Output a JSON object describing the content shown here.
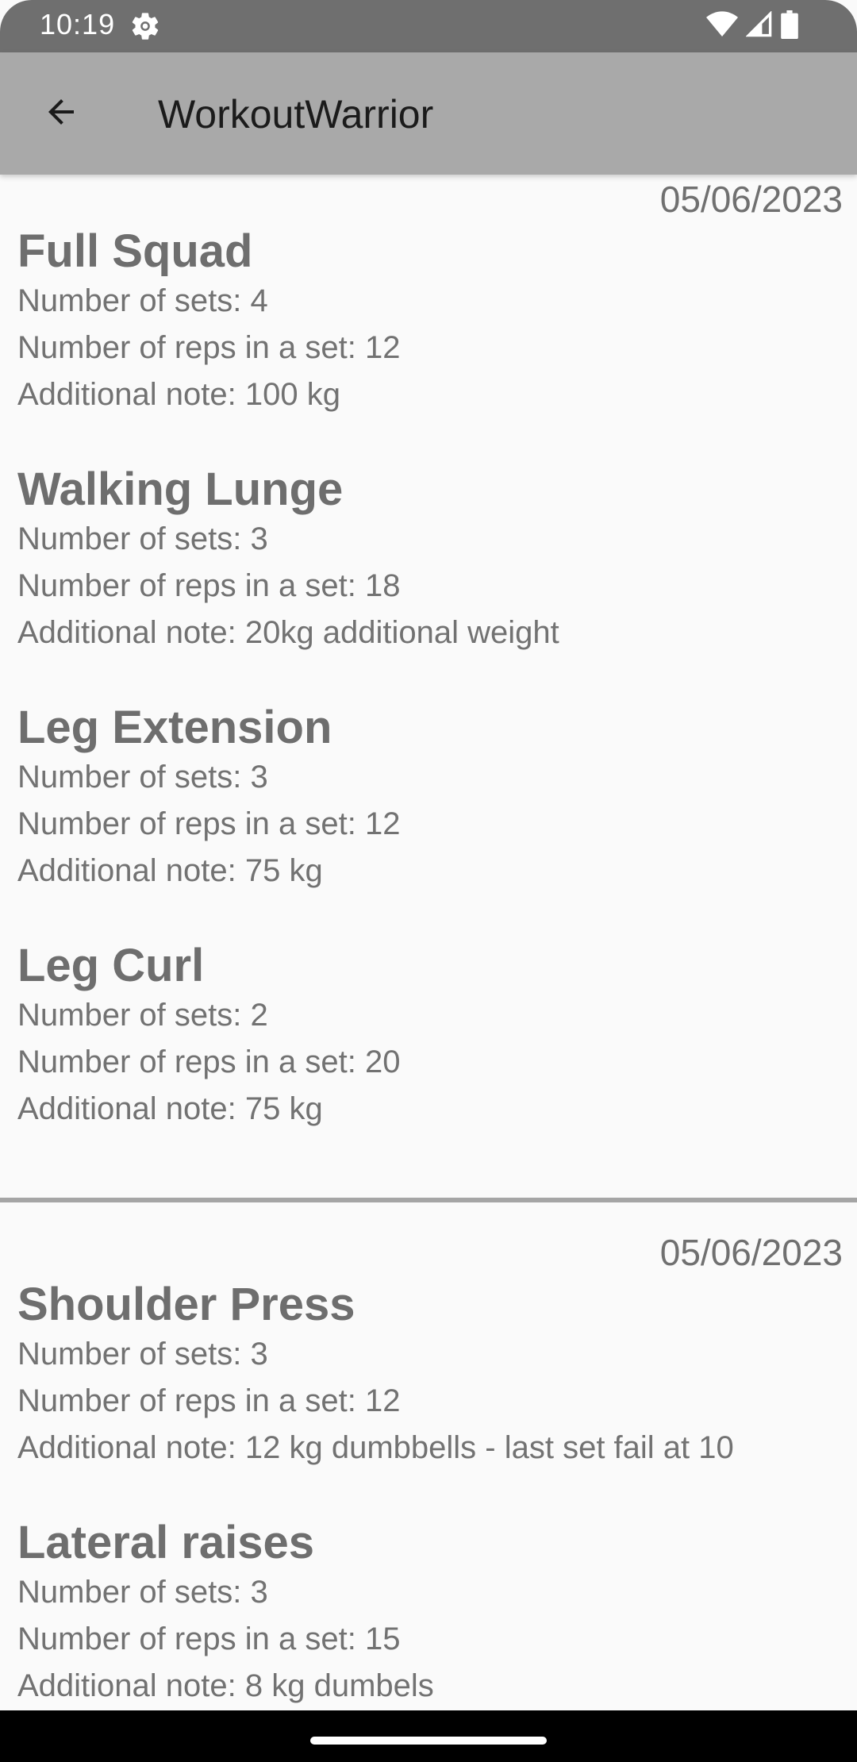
{
  "status_bar": {
    "time": "10:19",
    "icons": [
      "settings-gear-icon",
      "wifi-icon",
      "signal-icon",
      "battery-icon"
    ]
  },
  "app_bar": {
    "back_icon": "arrow-left-icon",
    "title": "WorkoutWarrior"
  },
  "labels": {
    "sets": "Number of sets: ",
    "reps": "Number of reps in a set: ",
    "note": "Additional note: "
  },
  "workouts": [
    {
      "date": "05/06/2023",
      "exercises": [
        {
          "name": "Full Squad",
          "sets": "4",
          "reps": "12",
          "note": "100 kg"
        },
        {
          "name": "Walking Lunge",
          "sets": "3",
          "reps": "18",
          "note": "20kg additional weight"
        },
        {
          "name": "Leg Extension",
          "sets": "3",
          "reps": "12",
          "note": "75 kg"
        },
        {
          "name": "Leg Curl",
          "sets": "2",
          "reps": "20",
          "note": "75 kg"
        }
      ]
    },
    {
      "date": "05/06/2023",
      "exercises": [
        {
          "name": "Shoulder Press",
          "sets": "3",
          "reps": "12",
          "note": "12 kg dumbbells - last set fail at 10"
        },
        {
          "name": "Lateral raises",
          "sets": "3",
          "reps": "15",
          "note": "8 kg dumbels"
        }
      ]
    }
  ],
  "colors": {
    "status_bar": "#6f6f6f",
    "app_bar": "#a9a9a9",
    "background": "#fafafa",
    "text": "#707070",
    "divider": "#a5a5a5"
  }
}
